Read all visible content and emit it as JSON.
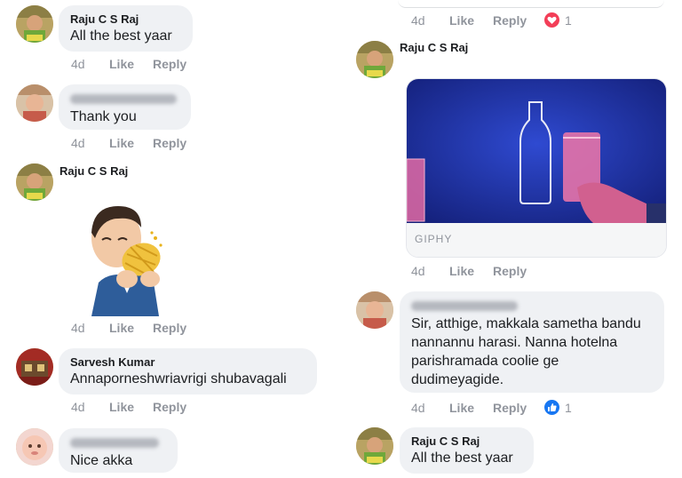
{
  "meta": {
    "time": "4d",
    "like": "Like",
    "reply": "Reply"
  },
  "left": {
    "c1": {
      "name": "Raju C S Raj",
      "text": "All the best yaar"
    },
    "c2": {
      "text": "Thank you"
    },
    "c3": {
      "name": "Raju C S Raj"
    },
    "c4": {
      "name": "Sarvesh Kumar",
      "text": "Annaporneshwriavrigi shubavagali"
    },
    "c5": {
      "text": "Nice akka"
    }
  },
  "right": {
    "top": {
      "reaction_count": "1"
    },
    "c1": {
      "name": "Raju C S Raj",
      "giphy_label": "GIPHY"
    },
    "c2": {
      "lines": [
        "Sir, atthige, makkala sametha bandu",
        "nannannu harasi. Nanna hotelna",
        "parishramada coolie ge",
        "dudimeyagide."
      ],
      "reaction_count": "1"
    },
    "c3": {
      "name": "Raju C S Raj",
      "text": "All the best yaar"
    }
  },
  "colors": {
    "bubble": "#eff1f4",
    "meta": "#90949c",
    "love": "#f33e58",
    "like": "#1877f2",
    "giphy_bg": "#1b2a8f"
  }
}
